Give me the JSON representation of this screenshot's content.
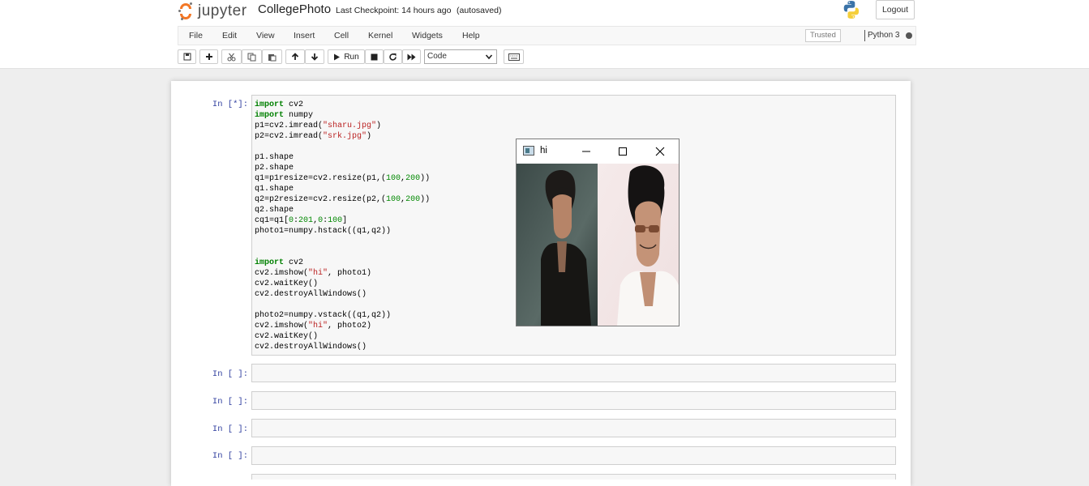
{
  "header": {
    "logo_text": "jupyter",
    "notebook_name": "CollegePhoto",
    "checkpoint": "Last Checkpoint: 14 hours ago",
    "autosave": "(autosaved)",
    "logout_label": "Logout"
  },
  "menubar": {
    "items": [
      "File",
      "Edit",
      "View",
      "Insert",
      "Cell",
      "Kernel",
      "Widgets",
      "Help"
    ],
    "trusted": "Trusted",
    "kernel_name": "Python 3"
  },
  "toolbar": {
    "buttons": [
      "save-icon",
      "plus-icon",
      "cut-icon",
      "copy-icon",
      "paste-icon",
      "arrow-up-icon",
      "arrow-down-icon",
      "play-icon",
      "stop-icon",
      "restart-icon",
      "fast-forward-icon",
      "keyboard-icon"
    ],
    "run_label": "Run",
    "cell_type": "Code"
  },
  "cells": [
    {
      "prompt": "In [*]:"
    },
    {
      "prompt": "In [ ]:"
    },
    {
      "prompt": "In [ ]:"
    },
    {
      "prompt": "In [ ]:"
    },
    {
      "prompt": "In [ ]:"
    }
  ],
  "code_lines": [
    "import cv2",
    "import numpy",
    "p1=cv2.imread(\"sharu.jpg\")",
    "p2=cv2.imread(\"srk.jpg\")",
    "",
    "p1.shape",
    "p2.shape",
    "q1=p1resize=cv2.resize(p1,(100,200))",
    "q1.shape",
    "q2=p2resize=cv2.resize(p2,(100,200))",
    "q2.shape",
    "cq1=q1[0:201,0:100]",
    "photo1=numpy.hstack((q1,q2))",
    "",
    "",
    "import cv2",
    "cv2.imshow(\"hi\", photo1)",
    "cv2.waitKey()",
    "cv2.destroyAllWindows()",
    "",
    "photo2=numpy.vstack((q1,q2))",
    "cv2.imshow(\"hi\", photo2)",
    "cv2.waitKey()",
    "cv2.destroyAllWindows()"
  ],
  "window": {
    "title": "hi",
    "controls": [
      "minimize-icon",
      "maximize-icon",
      "close-icon"
    ]
  },
  "colors": {
    "logo_orange": "#f37726",
    "prompt_blue": "#303f9f",
    "keyword_green": "#008000",
    "string_red": "#ba2121"
  }
}
